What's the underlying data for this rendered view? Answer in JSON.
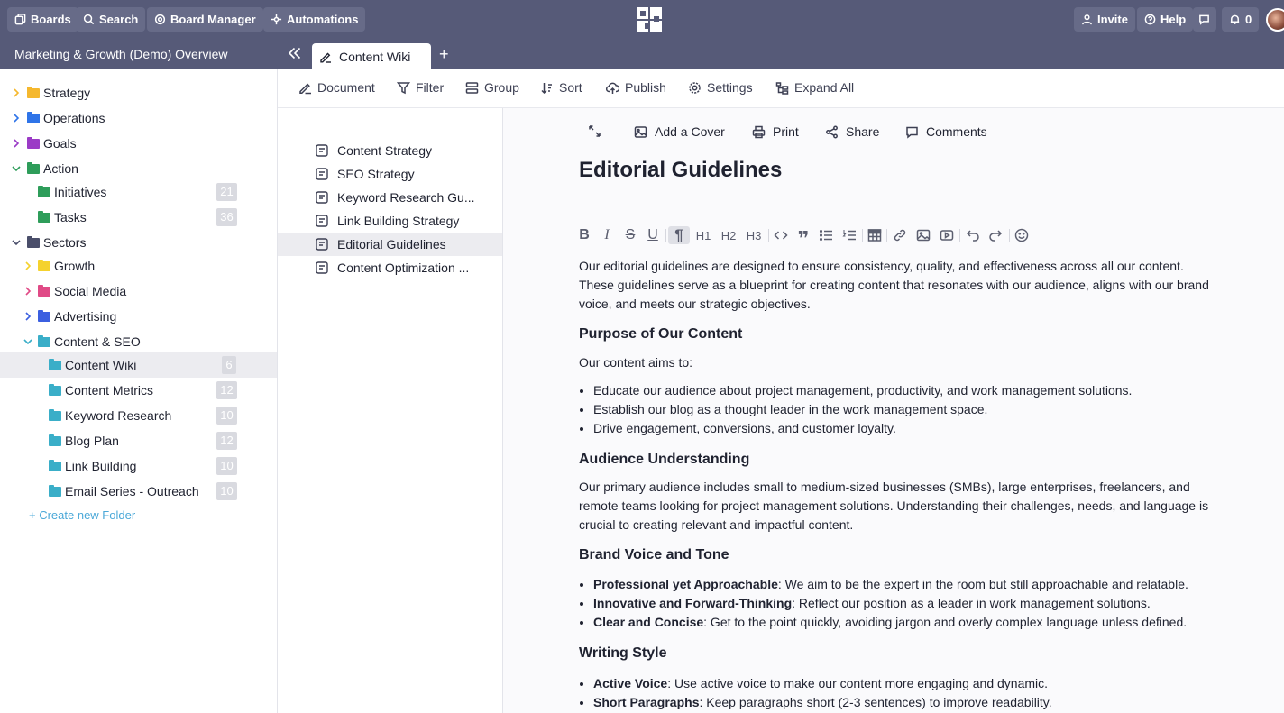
{
  "topbar": {
    "boards": "Boards",
    "search": "Search",
    "board_manager": "Board Manager",
    "automations": "Automations",
    "invite": "Invite",
    "help": "Help",
    "notifications": "0"
  },
  "subbar": {
    "workspace_title": "Marketing & Growth (Demo) Overview",
    "tab_label": "Content Wiki"
  },
  "sidebar": {
    "items": [
      {
        "label": "Strategy",
        "color": "#f5b82e"
      },
      {
        "label": "Operations",
        "color": "#2f74e8"
      },
      {
        "label": "Goals",
        "color": "#9b3bc6"
      },
      {
        "label": "Action",
        "color": "#2e9d5a"
      },
      {
        "label": "Initiatives",
        "count": "21",
        "color": "#2e9d5a"
      },
      {
        "label": "Tasks",
        "count": "36",
        "color": "#2e9d5a"
      },
      {
        "label": "Sectors",
        "color": "#4a4e6a"
      },
      {
        "label": "Growth",
        "color": "#f5d22e"
      },
      {
        "label": "Social Media",
        "color": "#e04a86"
      },
      {
        "label": "Advertising",
        "color": "#3b5fe0"
      },
      {
        "label": "Content & SEO",
        "color": "#3aaec8"
      },
      {
        "label": "Content Wiki",
        "count": "6",
        "color": "#3aaec8"
      },
      {
        "label": "Content Metrics",
        "count": "12",
        "color": "#3aaec8"
      },
      {
        "label": "Keyword Research",
        "count": "10",
        "color": "#3aaec8"
      },
      {
        "label": "Blog Plan",
        "count": "12",
        "color": "#3aaec8"
      },
      {
        "label": "Link Building",
        "count": "10",
        "color": "#3aaec8"
      },
      {
        "label": "Email Series - Outreach",
        "count": "10",
        "color": "#3aaec8"
      }
    ],
    "create_folder": "+ Create new Folder"
  },
  "toolbar": {
    "document": "Document",
    "filter": "Filter",
    "group": "Group",
    "sort": "Sort",
    "publish": "Publish",
    "settings": "Settings",
    "expand_all": "Expand All"
  },
  "doclist": {
    "items": [
      "Content Strategy",
      "SEO Strategy",
      "Keyword Research Gu...",
      "Link Building Strategy",
      "Editorial Guidelines",
      "Content Optimization ..."
    ]
  },
  "editor": {
    "add_cover": "Add a Cover",
    "print": "Print",
    "share": "Share",
    "comments": "Comments",
    "title": "Editorial Guidelines",
    "fmt": {
      "h1": "H1",
      "h2": "H2",
      "h3": "H3"
    },
    "intro": "Our editorial guidelines are designed to ensure consistency, quality, and effectiveness across all our content. These guidelines serve as a blueprint for creating content that resonates with our audience, aligns with our brand voice, and meets our strategic objectives.",
    "purpose_heading": "Purpose of Our Content",
    "purpose_lead": "Our content aims to:",
    "purpose_list": [
      "Educate our audience about project management, productivity, and work management solutions.",
      "Establish our blog as a thought leader in the work management space.",
      "Drive engagement, conversions, and customer loyalty."
    ],
    "audience_heading": "Audience Understanding",
    "audience_text": "Our primary audience includes small to medium-sized businesses (SMBs), large enterprises, freelancers, and remote teams looking for project management solutions. Understanding their challenges, needs, and language is crucial to creating relevant and impactful content.",
    "brand_heading": "Brand Voice and Tone",
    "brand_list": [
      {
        "bold": "Professional yet Approachable",
        "text": ": We aim to be the expert in the room but still approachable and relatable."
      },
      {
        "bold": "Innovative and Forward-Thinking",
        "text": ": Reflect our position as a leader in work management solutions."
      },
      {
        "bold": "Clear and Concise",
        "text": ": Get to the point quickly, avoiding jargon and overly complex language unless defined."
      }
    ],
    "writing_heading": "Writing Style",
    "writing_list": [
      {
        "bold": "Active Voice",
        "text": ": Use active voice to make our content more engaging and dynamic."
      },
      {
        "bold": "Short Paragraphs",
        "text": ": Keep paragraphs short (2-3 sentences) to improve readability."
      }
    ]
  }
}
